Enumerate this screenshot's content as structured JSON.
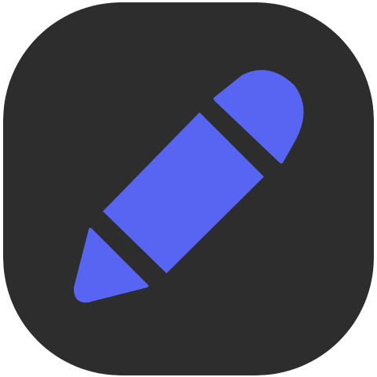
{
  "icon": {
    "name": "pencil-icon",
    "background_color": "#2d2d2d",
    "glyph_color": "#5865f2"
  }
}
